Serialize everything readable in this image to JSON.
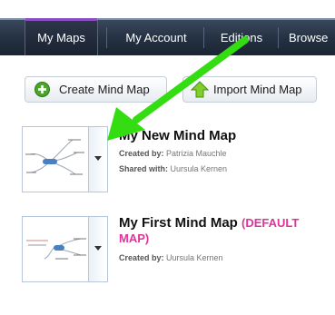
{
  "nav": {
    "tabs": [
      {
        "label": "My Maps",
        "active": true
      },
      {
        "label": "My Account",
        "active": false
      },
      {
        "label": "Editions",
        "active": false
      },
      {
        "label": "Browse",
        "active": false
      }
    ]
  },
  "toolbar": {
    "create_label": "Create Mind Map",
    "import_label": "Import Mind Map"
  },
  "maps": [
    {
      "title": "My New Mind Map",
      "created_by_label": "Created by:",
      "created_by": "Patrizia Mauchle",
      "shared_with_label": "Shared with:",
      "shared_with": "Uursula Kernen"
    },
    {
      "title": "My First Mind Map",
      "default_tag": "(DEFAULT MAP)",
      "created_by_label": "Created by:",
      "created_by": "Uursula Kernen"
    }
  ],
  "colors": {
    "nav_background": "#243142",
    "active_tab_accent": "#8a4fc1",
    "default_tag": "#e0339a",
    "annotation_arrow": "#33dd11"
  }
}
